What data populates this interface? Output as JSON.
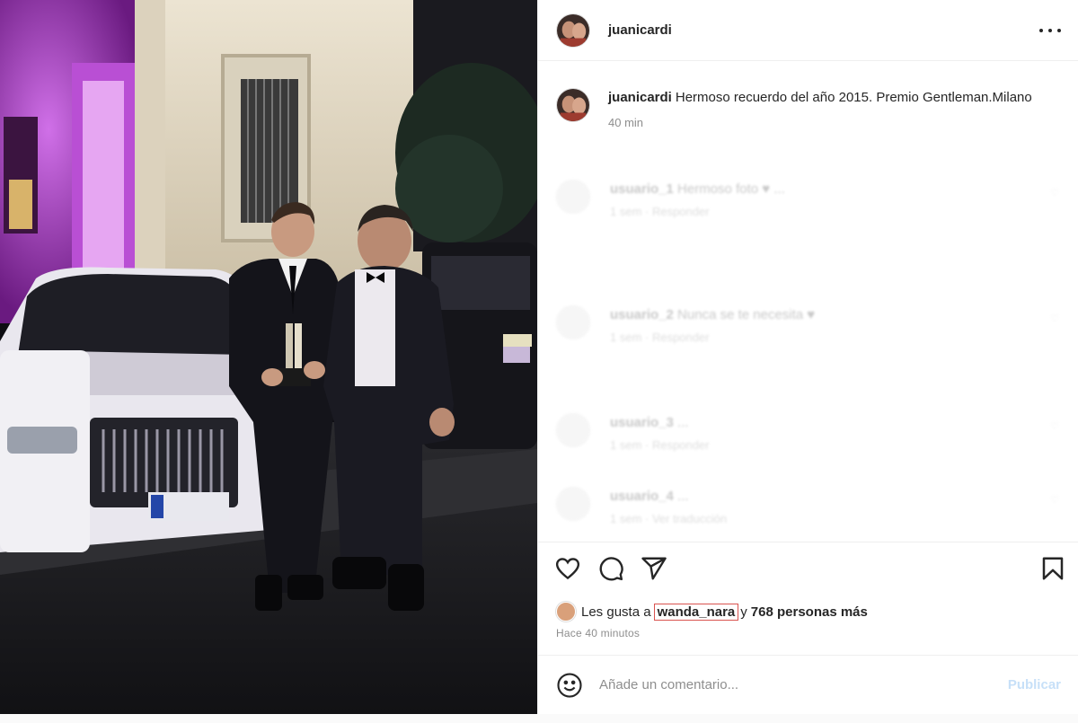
{
  "post": {
    "username": "juanicardi",
    "caption": {
      "username": "juanicardi",
      "text": "Hermoso recuerdo del año 2015. Premio Gentleman.Milano",
      "time": "40 min"
    },
    "comments": [
      {
        "username": "usuario_1",
        "text": "Hermoso foto ♥ ...",
        "meta": "1 sem  ·  Responder"
      },
      {
        "username": "usuario_2",
        "text": "Nunca se te necesita ♥",
        "meta": "1 sem  ·  Responder"
      },
      {
        "username": "usuario_3",
        "text": "...",
        "meta": "1 sem  ·  Responder"
      },
      {
        "username": "usuario_4",
        "text": "...",
        "meta": "1 sem  ·  Ver traducción"
      }
    ],
    "icons": {
      "like": "heart-icon",
      "comment": "comment-icon",
      "share": "send-icon",
      "save": "bookmark-icon",
      "more": "more-icon",
      "emoji": "smile-icon"
    },
    "likes": {
      "prefix": "Les gusta a",
      "liker": "wanda_nara",
      "suffix_y": "y",
      "count_text": "768 personas más"
    },
    "timestamp": "Hace 40 minutos",
    "comment_placeholder": "Añade un comentario...",
    "publish_label": "Publicar"
  },
  "colors": {
    "liker_highlight": "#d9534f",
    "publish_disabled": "#c7e0f8",
    "text_primary": "#262626",
    "text_secondary": "#8e8e8e"
  }
}
